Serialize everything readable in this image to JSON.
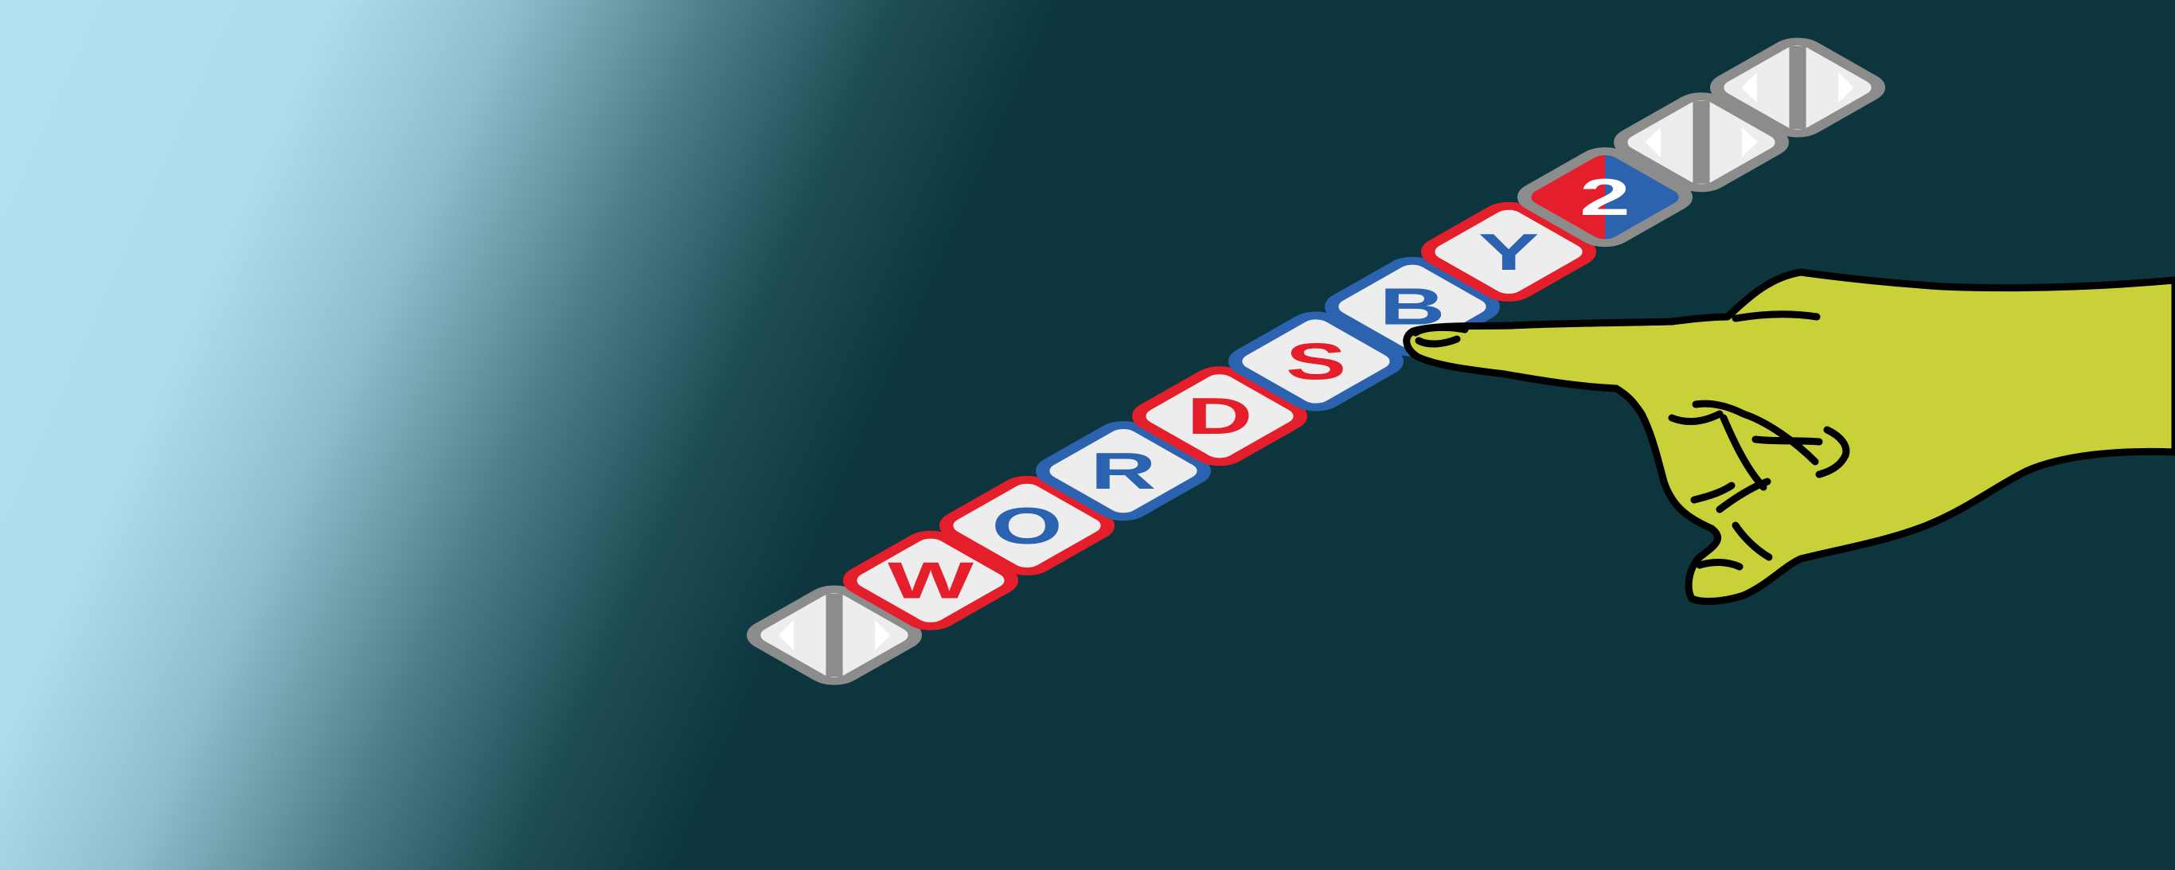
{
  "logo": {
    "letters": [
      {
        "char": "W",
        "border": "#e41e2b",
        "text": "#e41e2b"
      },
      {
        "char": "O",
        "border": "#e41e2b",
        "text": "#2b63b0"
      },
      {
        "char": "R",
        "border": "#2b63b0",
        "text": "#2b63b0"
      },
      {
        "char": "D",
        "border": "#e41e2b",
        "text": "#e41e2b"
      },
      {
        "char": "S",
        "border": "#2b63b0",
        "text": "#e41e2b"
      },
      {
        "char": "B",
        "border": "#2b63b0",
        "text": "#2b63b0"
      },
      {
        "char": "Y",
        "border": "#e41e2b",
        "text": "#2b63b0"
      }
    ],
    "badge": {
      "char": "2",
      "border": "#8c8c8c",
      "fill_left": "#e41e2b",
      "fill_right": "#2b63b0",
      "text": "#ffffff"
    },
    "tile_fill": "#ededed",
    "arrow_tile": {
      "border": "#8c8c8c",
      "fill": "#ededed",
      "icon": "left-right-arrows-icon"
    }
  },
  "hand": {
    "color": "#c9d138",
    "outline": "#000000",
    "icon": "pointing-hand-icon"
  },
  "background": {
    "light": "#b3e1ef",
    "dark": "#0c353e"
  }
}
